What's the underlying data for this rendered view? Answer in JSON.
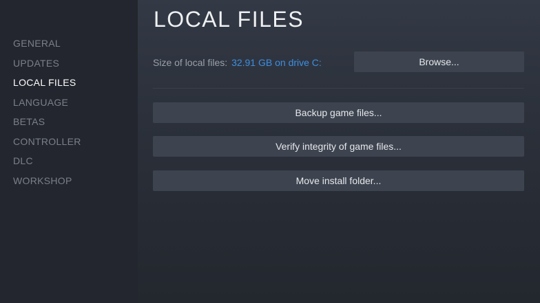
{
  "sidebar": {
    "items": [
      {
        "label": "GENERAL"
      },
      {
        "label": "UPDATES"
      },
      {
        "label": "LOCAL FILES"
      },
      {
        "label": "LANGUAGE"
      },
      {
        "label": "BETAS"
      },
      {
        "label": "CONTROLLER"
      },
      {
        "label": "DLC"
      },
      {
        "label": "WORKSHOP"
      }
    ],
    "active": "LOCAL FILES"
  },
  "main": {
    "title": "LOCAL FILES",
    "size_label": "Size of local files:",
    "size_value": "32.91 GB on drive C:",
    "browse_label": "Browse...",
    "backup_label": "Backup game files...",
    "verify_label": "Verify integrity of game files...",
    "move_label": "Move install folder..."
  },
  "colors": {
    "accent_link": "#3d8fe0",
    "button_bg": "#3d4450",
    "sidebar_bg": "#23262e",
    "active_text": "#ffffff",
    "inactive_text": "#7b8088"
  }
}
